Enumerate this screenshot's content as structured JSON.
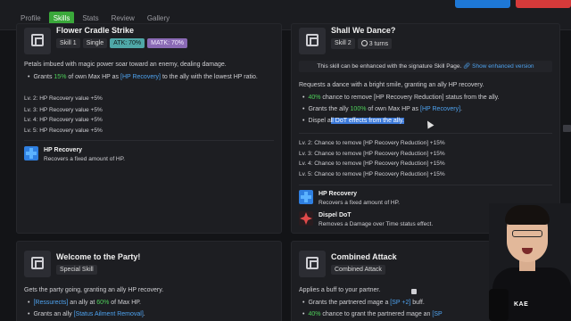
{
  "tabs": [
    {
      "label": "Profile"
    },
    {
      "label": "Skills"
    },
    {
      "label": "Stats"
    },
    {
      "label": "Review"
    },
    {
      "label": "Gallery"
    }
  ],
  "skill1": {
    "title": "Flower Cradle Strike",
    "tags": [
      "Skill 1",
      "Single",
      "ATK: 70%",
      "MATK: 70%"
    ],
    "desc": "Petals imbued with magic power soar toward an enemy, dealing damage.",
    "bullet_pre": "Grants ",
    "bullet_pct": "15%",
    "bullet_mid": " of own Max HP as ",
    "bullet_kw": "[HP Recovery]",
    "bullet_post": " to the ally with the lowest HP ratio.",
    "levels": [
      "Lv. 2: HP Recovery value +5%",
      "Lv. 3: HP Recovery value +5%",
      "Lv. 4: HP Recovery value +5%",
      "Lv. 5: HP Recovery value +5%"
    ],
    "effect_name": "HP Recovery",
    "effect_desc": "Recovers a fixed amount of HP."
  },
  "skill2": {
    "title": "Shall We Dance?",
    "tags": [
      "Skill 2",
      "3 turns"
    ],
    "notice_text": "This skill can be enhanced with the signature Skill Page.",
    "notice_link": "Show enhanced version",
    "desc": "Requests a dance with a bright smile, granting an ally HP recovery.",
    "b1_pct": "40%",
    "b1_post": " chance to remove [HP Recovery Reduction] status from the ally.",
    "b2_pre": "Grants the ally ",
    "b2_pct": "100%",
    "b2_mid": " of own Max HP as ",
    "b2_kw": "[HP Recovery]",
    "b2_post": ".",
    "b3_pre": "Dispel a",
    "b3_sel": "ll DoT effects from the ally.",
    "levels": [
      "Lv. 2: Chance to remove [HP Recovery Reduction] +15%",
      "Lv. 3: Chance to remove [HP Recovery Reduction] +15%",
      "Lv. 4: Chance to remove [HP Recovery Reduction] +15%",
      "Lv. 5: Chance to remove [HP Recovery Reduction] +15%"
    ],
    "effect1_name": "HP Recovery",
    "effect1_desc": "Recovers a fixed amount of HP.",
    "effect2_name": "Dispel DoT",
    "effect2_desc": "Removes a Damage over Time status effect."
  },
  "skill3": {
    "title": "Welcome to the Party!",
    "tag": "Special Skill",
    "desc": "Gets the party going, granting an ally HP recovery.",
    "b1_kw": "[Ressurects]",
    "b1_mid": " an ally at ",
    "b1_pct": "60%",
    "b1_post": " of Max HP.",
    "b2_pre": "Grants an ally ",
    "b2_kw": "[Status Ailment Removal]",
    "b2_post": "."
  },
  "skill4": {
    "title": "Combined Attack",
    "tag": "Combined Attack",
    "desc": "Applies a buff to your partner.",
    "b1_pre": "Grants the partnered mage a ",
    "b1_kw": "[SP +2]",
    "b1_post": " buff.",
    "b2_pct": "40%",
    "b2_post": " chance to grant the partnered mage an ",
    "b2_kw": "[SP"
  },
  "webcam": {
    "brand": "KAE"
  },
  "colors": {
    "accent_green": "#3aa83a",
    "highlight_green": "#4ed05a",
    "highlight_blue": "#4ea3f0",
    "selection": "#3d7ad9",
    "atk_tag": "#4fa7a7",
    "matk_tag": "#8a6ab5"
  }
}
